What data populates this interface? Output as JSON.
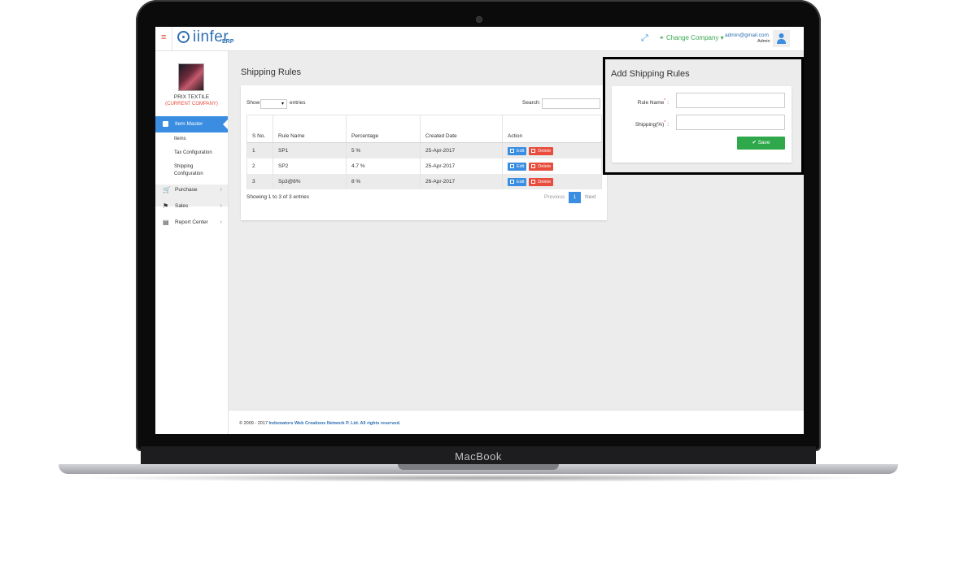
{
  "device": {
    "brand": "MacBook"
  },
  "app": {
    "logo_text": "iinfer",
    "logo_suffix": "ERP",
    "menu_icon": "hamburger-icon",
    "expand_icon": "expand-icon",
    "change_company": "Change Company",
    "user_email": "admin@gmail.com",
    "user_role": "Admin",
    "user_icon": "user-icon"
  },
  "sidebar": {
    "company_name": "PRIX TEXTILE",
    "company_tag": "(CURRENT COMPANY)",
    "active_section": "Item Master",
    "submenu": [
      "Items",
      "Tax Configuration",
      "Shipping",
      "Configuration"
    ],
    "nav": [
      {
        "label": "Purchase",
        "icon": "cart-icon"
      },
      {
        "label": "Sales",
        "icon": "tag-icon"
      },
      {
        "label": "Report Center",
        "icon": "bar-chart-icon"
      }
    ]
  },
  "main": {
    "title": "Shipping Rules",
    "show_label": "Show",
    "entries_label": "entries",
    "search_label": "Search:",
    "columns": [
      "S No.",
      "Rule Name",
      "Percentage",
      "Created Date",
      "Action"
    ],
    "rows": [
      {
        "sno": "1",
        "rule": "SP1",
        "pct": "5 %",
        "date": "25-Apr-2017"
      },
      {
        "sno": "2",
        "rule": "SP2",
        "pct": "4.7 %",
        "date": "25-Apr-2017"
      },
      {
        "sno": "3",
        "rule": "Sp3@8%",
        "pct": "8 %",
        "date": "26-Apr-2017"
      }
    ],
    "edit_label": "Edit",
    "delete_label": "Delete",
    "showing": "Showing 1 to 3 of 3 entries",
    "prev": "Previous",
    "page": "1",
    "next": "Next"
  },
  "add_form": {
    "title": "Add Shipping Rules",
    "rule_name_label": "Rule Name",
    "shipping_label": "Shipping(%)",
    "required_mark": "*",
    "colon": ":",
    "save_label": "Save"
  },
  "footer": {
    "text": "© 2009 - 2017",
    "link": "Indomators Web Creations Network P. Ltd. All rights reserved."
  },
  "colors": {
    "accent": "#3a8de0",
    "danger": "#e74c3c",
    "success": "#2ea84a",
    "highlight_border": "#000000"
  }
}
